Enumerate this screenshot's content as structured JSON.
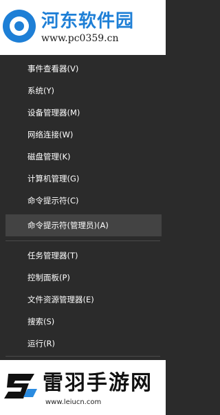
{
  "watermark_top": {
    "text": "河东软件园",
    "url": "www.pc0359.cn",
    "accent": "#1e7fd6"
  },
  "menu": {
    "items": [
      {
        "label": "事件查看器(V)"
      },
      {
        "label": "系统(Y)"
      },
      {
        "label": "设备管理器(M)"
      },
      {
        "label": "网络连接(W)"
      },
      {
        "label": "磁盘管理(K)"
      },
      {
        "label": "计算机管理(G)"
      },
      {
        "label": "命令提示符(C)"
      },
      {
        "label": "命令提示符(管理员)(A)"
      },
      {
        "label": "任务管理器(T)"
      },
      {
        "label": "控制面板(P)"
      },
      {
        "label": "文件资源管理器(E)"
      },
      {
        "label": "搜索(S)"
      },
      {
        "label": "运行(R)"
      }
    ]
  },
  "watermark_bottom": {
    "text": "雷羽手游网",
    "url": "www.leiucn.com"
  }
}
